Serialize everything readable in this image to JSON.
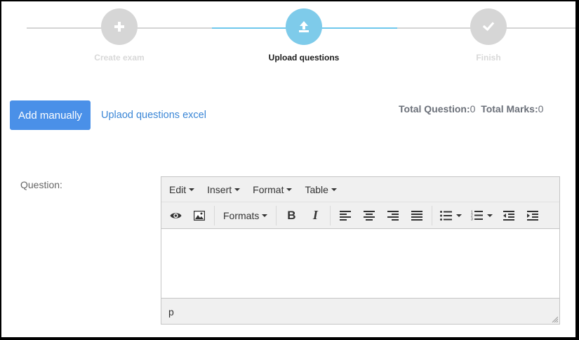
{
  "steps": [
    {
      "label": "Create exam",
      "icon": "plus-icon",
      "state": "inactive"
    },
    {
      "label": "Upload questions",
      "icon": "upload-icon",
      "state": "active"
    },
    {
      "label": "Finish",
      "icon": "check-icon",
      "state": "inactive"
    }
  ],
  "colors": {
    "accent": "#7ecbea",
    "button": "#4a90e8",
    "link": "#3a86d6",
    "inactive": "#d6d6d6"
  },
  "actions": {
    "add_manually": "Add manually",
    "upload_excel": "Uplaod questions excel"
  },
  "totals": {
    "question_label": "Total Question:",
    "question_value": "0",
    "marks_label": "Total Marks:",
    "marks_value": "0"
  },
  "question_label": "Question:",
  "editor": {
    "menus": [
      "Edit",
      "Insert",
      "Format",
      "Table"
    ],
    "formats_label": "Formats",
    "toolbar_icons": [
      "preview-icon",
      "image-icon",
      "bold-icon",
      "italic-icon",
      "align-left-icon",
      "align-center-icon",
      "align-right-icon",
      "align-justify-icon",
      "bullet-list-icon",
      "numbered-list-icon",
      "outdent-icon",
      "indent-icon"
    ],
    "bold_glyph": "B",
    "italic_glyph": "I",
    "status_path": "p"
  }
}
